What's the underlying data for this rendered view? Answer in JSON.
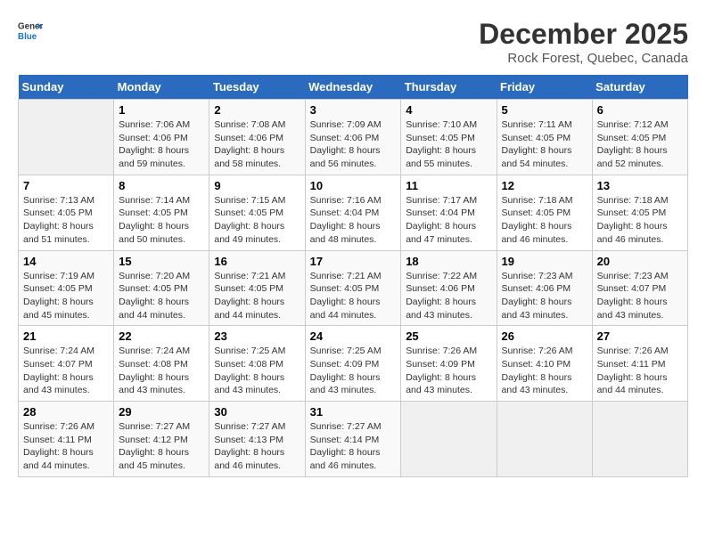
{
  "header": {
    "logo_line1": "General",
    "logo_line2": "Blue",
    "title": "December 2025",
    "subtitle": "Rock Forest, Quebec, Canada"
  },
  "weekdays": [
    "Sunday",
    "Monday",
    "Tuesday",
    "Wednesday",
    "Thursday",
    "Friday",
    "Saturday"
  ],
  "weeks": [
    [
      {
        "day": "",
        "sunrise": "",
        "sunset": "",
        "daylight": ""
      },
      {
        "day": "1",
        "sunrise": "Sunrise: 7:06 AM",
        "sunset": "Sunset: 4:06 PM",
        "daylight": "Daylight: 8 hours and 59 minutes."
      },
      {
        "day": "2",
        "sunrise": "Sunrise: 7:08 AM",
        "sunset": "Sunset: 4:06 PM",
        "daylight": "Daylight: 8 hours and 58 minutes."
      },
      {
        "day": "3",
        "sunrise": "Sunrise: 7:09 AM",
        "sunset": "Sunset: 4:06 PM",
        "daylight": "Daylight: 8 hours and 56 minutes."
      },
      {
        "day": "4",
        "sunrise": "Sunrise: 7:10 AM",
        "sunset": "Sunset: 4:05 PM",
        "daylight": "Daylight: 8 hours and 55 minutes."
      },
      {
        "day": "5",
        "sunrise": "Sunrise: 7:11 AM",
        "sunset": "Sunset: 4:05 PM",
        "daylight": "Daylight: 8 hours and 54 minutes."
      },
      {
        "day": "6",
        "sunrise": "Sunrise: 7:12 AM",
        "sunset": "Sunset: 4:05 PM",
        "daylight": "Daylight: 8 hours and 52 minutes."
      }
    ],
    [
      {
        "day": "7",
        "sunrise": "Sunrise: 7:13 AM",
        "sunset": "Sunset: 4:05 PM",
        "daylight": "Daylight: 8 hours and 51 minutes."
      },
      {
        "day": "8",
        "sunrise": "Sunrise: 7:14 AM",
        "sunset": "Sunset: 4:05 PM",
        "daylight": "Daylight: 8 hours and 50 minutes."
      },
      {
        "day": "9",
        "sunrise": "Sunrise: 7:15 AM",
        "sunset": "Sunset: 4:05 PM",
        "daylight": "Daylight: 8 hours and 49 minutes."
      },
      {
        "day": "10",
        "sunrise": "Sunrise: 7:16 AM",
        "sunset": "Sunset: 4:04 PM",
        "daylight": "Daylight: 8 hours and 48 minutes."
      },
      {
        "day": "11",
        "sunrise": "Sunrise: 7:17 AM",
        "sunset": "Sunset: 4:04 PM",
        "daylight": "Daylight: 8 hours and 47 minutes."
      },
      {
        "day": "12",
        "sunrise": "Sunrise: 7:18 AM",
        "sunset": "Sunset: 4:05 PM",
        "daylight": "Daylight: 8 hours and 46 minutes."
      },
      {
        "day": "13",
        "sunrise": "Sunrise: 7:18 AM",
        "sunset": "Sunset: 4:05 PM",
        "daylight": "Daylight: 8 hours and 46 minutes."
      }
    ],
    [
      {
        "day": "14",
        "sunrise": "Sunrise: 7:19 AM",
        "sunset": "Sunset: 4:05 PM",
        "daylight": "Daylight: 8 hours and 45 minutes."
      },
      {
        "day": "15",
        "sunrise": "Sunrise: 7:20 AM",
        "sunset": "Sunset: 4:05 PM",
        "daylight": "Daylight: 8 hours and 44 minutes."
      },
      {
        "day": "16",
        "sunrise": "Sunrise: 7:21 AM",
        "sunset": "Sunset: 4:05 PM",
        "daylight": "Daylight: 8 hours and 44 minutes."
      },
      {
        "day": "17",
        "sunrise": "Sunrise: 7:21 AM",
        "sunset": "Sunset: 4:05 PM",
        "daylight": "Daylight: 8 hours and 44 minutes."
      },
      {
        "day": "18",
        "sunrise": "Sunrise: 7:22 AM",
        "sunset": "Sunset: 4:06 PM",
        "daylight": "Daylight: 8 hours and 43 minutes."
      },
      {
        "day": "19",
        "sunrise": "Sunrise: 7:23 AM",
        "sunset": "Sunset: 4:06 PM",
        "daylight": "Daylight: 8 hours and 43 minutes."
      },
      {
        "day": "20",
        "sunrise": "Sunrise: 7:23 AM",
        "sunset": "Sunset: 4:07 PM",
        "daylight": "Daylight: 8 hours and 43 minutes."
      }
    ],
    [
      {
        "day": "21",
        "sunrise": "Sunrise: 7:24 AM",
        "sunset": "Sunset: 4:07 PM",
        "daylight": "Daylight: 8 hours and 43 minutes."
      },
      {
        "day": "22",
        "sunrise": "Sunrise: 7:24 AM",
        "sunset": "Sunset: 4:08 PM",
        "daylight": "Daylight: 8 hours and 43 minutes."
      },
      {
        "day": "23",
        "sunrise": "Sunrise: 7:25 AM",
        "sunset": "Sunset: 4:08 PM",
        "daylight": "Daylight: 8 hours and 43 minutes."
      },
      {
        "day": "24",
        "sunrise": "Sunrise: 7:25 AM",
        "sunset": "Sunset: 4:09 PM",
        "daylight": "Daylight: 8 hours and 43 minutes."
      },
      {
        "day": "25",
        "sunrise": "Sunrise: 7:26 AM",
        "sunset": "Sunset: 4:09 PM",
        "daylight": "Daylight: 8 hours and 43 minutes."
      },
      {
        "day": "26",
        "sunrise": "Sunrise: 7:26 AM",
        "sunset": "Sunset: 4:10 PM",
        "daylight": "Daylight: 8 hours and 43 minutes."
      },
      {
        "day": "27",
        "sunrise": "Sunrise: 7:26 AM",
        "sunset": "Sunset: 4:11 PM",
        "daylight": "Daylight: 8 hours and 44 minutes."
      }
    ],
    [
      {
        "day": "28",
        "sunrise": "Sunrise: 7:26 AM",
        "sunset": "Sunset: 4:11 PM",
        "daylight": "Daylight: 8 hours and 44 minutes."
      },
      {
        "day": "29",
        "sunrise": "Sunrise: 7:27 AM",
        "sunset": "Sunset: 4:12 PM",
        "daylight": "Daylight: 8 hours and 45 minutes."
      },
      {
        "day": "30",
        "sunrise": "Sunrise: 7:27 AM",
        "sunset": "Sunset: 4:13 PM",
        "daylight": "Daylight: 8 hours and 46 minutes."
      },
      {
        "day": "31",
        "sunrise": "Sunrise: 7:27 AM",
        "sunset": "Sunset: 4:14 PM",
        "daylight": "Daylight: 8 hours and 46 minutes."
      },
      {
        "day": "",
        "sunrise": "",
        "sunset": "",
        "daylight": ""
      },
      {
        "day": "",
        "sunrise": "",
        "sunset": "",
        "daylight": ""
      },
      {
        "day": "",
        "sunrise": "",
        "sunset": "",
        "daylight": ""
      }
    ]
  ]
}
